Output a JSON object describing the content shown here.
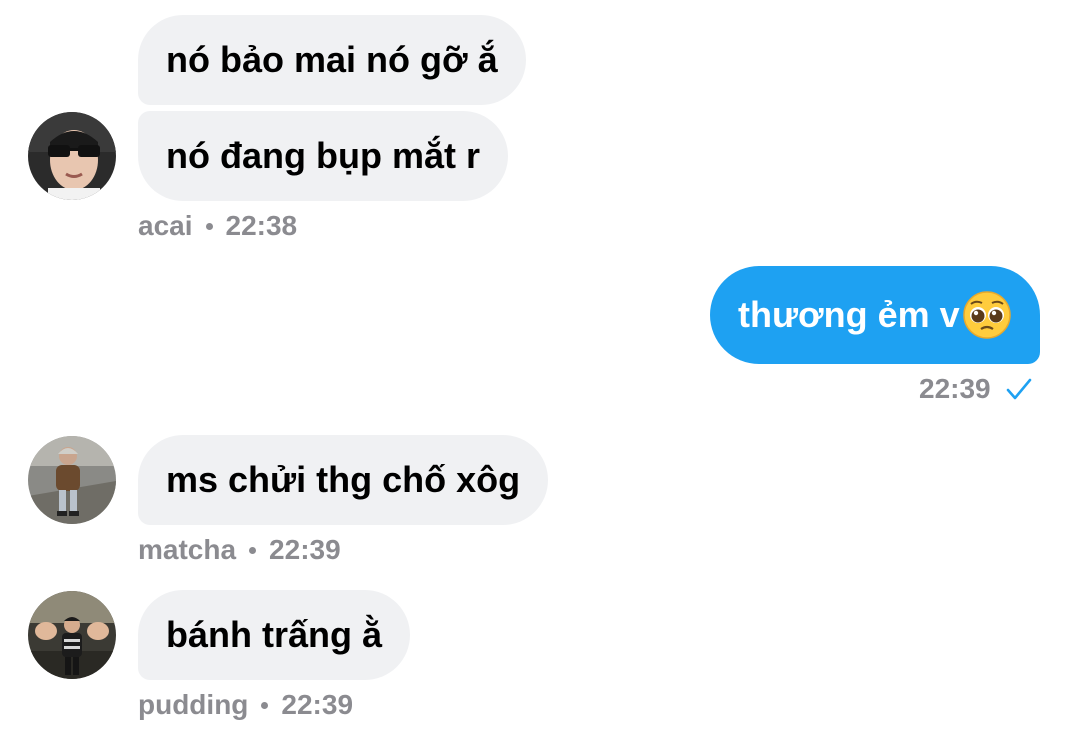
{
  "messages": {
    "acai": {
      "bubble1": "nó bảo mai nó gỡ ắ",
      "bubble2": "nó đang bụp mắt r",
      "sender": "acai",
      "time": "22:38",
      "avatar_icon": "avatar-acai"
    },
    "me": {
      "text": "thương ẻm v",
      "emoji_icon": "pleading-face-emoji",
      "time": "22:39",
      "status_icon": "check-icon",
      "bubble_color": "#1ea1f2"
    },
    "matcha": {
      "text": "ms chửi thg chố xôg",
      "sender": "matcha",
      "time": "22:39",
      "avatar_icon": "avatar-matcha"
    },
    "pudding": {
      "text": "bánh trấng ằ",
      "sender": "pudding",
      "time": "22:39",
      "avatar_icon": "avatar-pudding"
    }
  },
  "colors": {
    "incoming_bubble": "#f0f1f3",
    "meta_text": "#8b8b90",
    "check": "#1ea1f2"
  }
}
